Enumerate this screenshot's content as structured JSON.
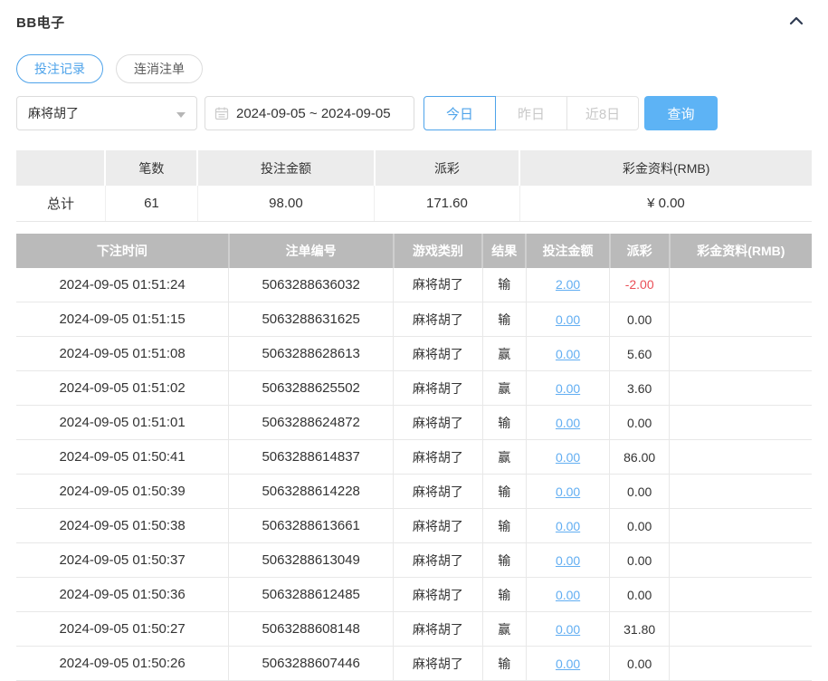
{
  "header": {
    "title": "BB电子"
  },
  "tabs": [
    {
      "label": "投注记录",
      "active": true
    },
    {
      "label": "连消注单",
      "active": false
    }
  ],
  "filters": {
    "game_select_value": "麻将胡了",
    "date_range_value": "2024-09-05 ~ 2024-09-05",
    "quick_ranges": [
      {
        "label": "今日",
        "active": true
      },
      {
        "label": "昨日",
        "active": false
      },
      {
        "label": "近8日",
        "active": false
      }
    ],
    "query_label": "查询"
  },
  "summary": {
    "columns": [
      "",
      "笔数",
      "投注金额",
      "派彩",
      "彩金资料(RMB)"
    ],
    "row": {
      "label": "总计",
      "count": "61",
      "bet_amount": "98.00",
      "payout": "171.60",
      "jackpot": "¥ 0.00"
    }
  },
  "records": {
    "columns": [
      "下注时间",
      "注单编号",
      "游戏类别",
      "结果",
      "投注金额",
      "派彩",
      "彩金资料(RMB)"
    ],
    "rows": [
      {
        "time": "2024-09-05 01:51:24",
        "order_id": "5063288636032",
        "game": "麻将胡了",
        "result": "输",
        "bet": "2.00",
        "payout": "-2.00",
        "jackpot": ""
      },
      {
        "time": "2024-09-05 01:51:15",
        "order_id": "5063288631625",
        "game": "麻将胡了",
        "result": "输",
        "bet": "0.00",
        "payout": "0.00",
        "jackpot": ""
      },
      {
        "time": "2024-09-05 01:51:08",
        "order_id": "5063288628613",
        "game": "麻将胡了",
        "result": "赢",
        "bet": "0.00",
        "payout": "5.60",
        "jackpot": ""
      },
      {
        "time": "2024-09-05 01:51:02",
        "order_id": "5063288625502",
        "game": "麻将胡了",
        "result": "赢",
        "bet": "0.00",
        "payout": "3.60",
        "jackpot": ""
      },
      {
        "time": "2024-09-05 01:51:01",
        "order_id": "5063288624872",
        "game": "麻将胡了",
        "result": "输",
        "bet": "0.00",
        "payout": "0.00",
        "jackpot": ""
      },
      {
        "time": "2024-09-05 01:50:41",
        "order_id": "5063288614837",
        "game": "麻将胡了",
        "result": "赢",
        "bet": "0.00",
        "payout": "86.00",
        "jackpot": ""
      },
      {
        "time": "2024-09-05 01:50:39",
        "order_id": "5063288614228",
        "game": "麻将胡了",
        "result": "输",
        "bet": "0.00",
        "payout": "0.00",
        "jackpot": ""
      },
      {
        "time": "2024-09-05 01:50:38",
        "order_id": "5063288613661",
        "game": "麻将胡了",
        "result": "输",
        "bet": "0.00",
        "payout": "0.00",
        "jackpot": ""
      },
      {
        "time": "2024-09-05 01:50:37",
        "order_id": "5063288613049",
        "game": "麻将胡了",
        "result": "输",
        "bet": "0.00",
        "payout": "0.00",
        "jackpot": ""
      },
      {
        "time": "2024-09-05 01:50:36",
        "order_id": "5063288612485",
        "game": "麻将胡了",
        "result": "输",
        "bet": "0.00",
        "payout": "0.00",
        "jackpot": ""
      },
      {
        "time": "2024-09-05 01:50:27",
        "order_id": "5063288608148",
        "game": "麻将胡了",
        "result": "赢",
        "bet": "0.00",
        "payout": "31.80",
        "jackpot": ""
      },
      {
        "time": "2024-09-05 01:50:26",
        "order_id": "5063288607446",
        "game": "麻将胡了",
        "result": "输",
        "bet": "0.00",
        "payout": "0.00",
        "jackpot": ""
      }
    ]
  },
  "colors": {
    "accent_blue": "#4ea3ea",
    "button_blue": "#5db3f5",
    "link_blue": "#62aef2",
    "negative_red": "#ea4f57",
    "records_header_bg": "#bababa",
    "summary_header_bg": "#ececec"
  }
}
